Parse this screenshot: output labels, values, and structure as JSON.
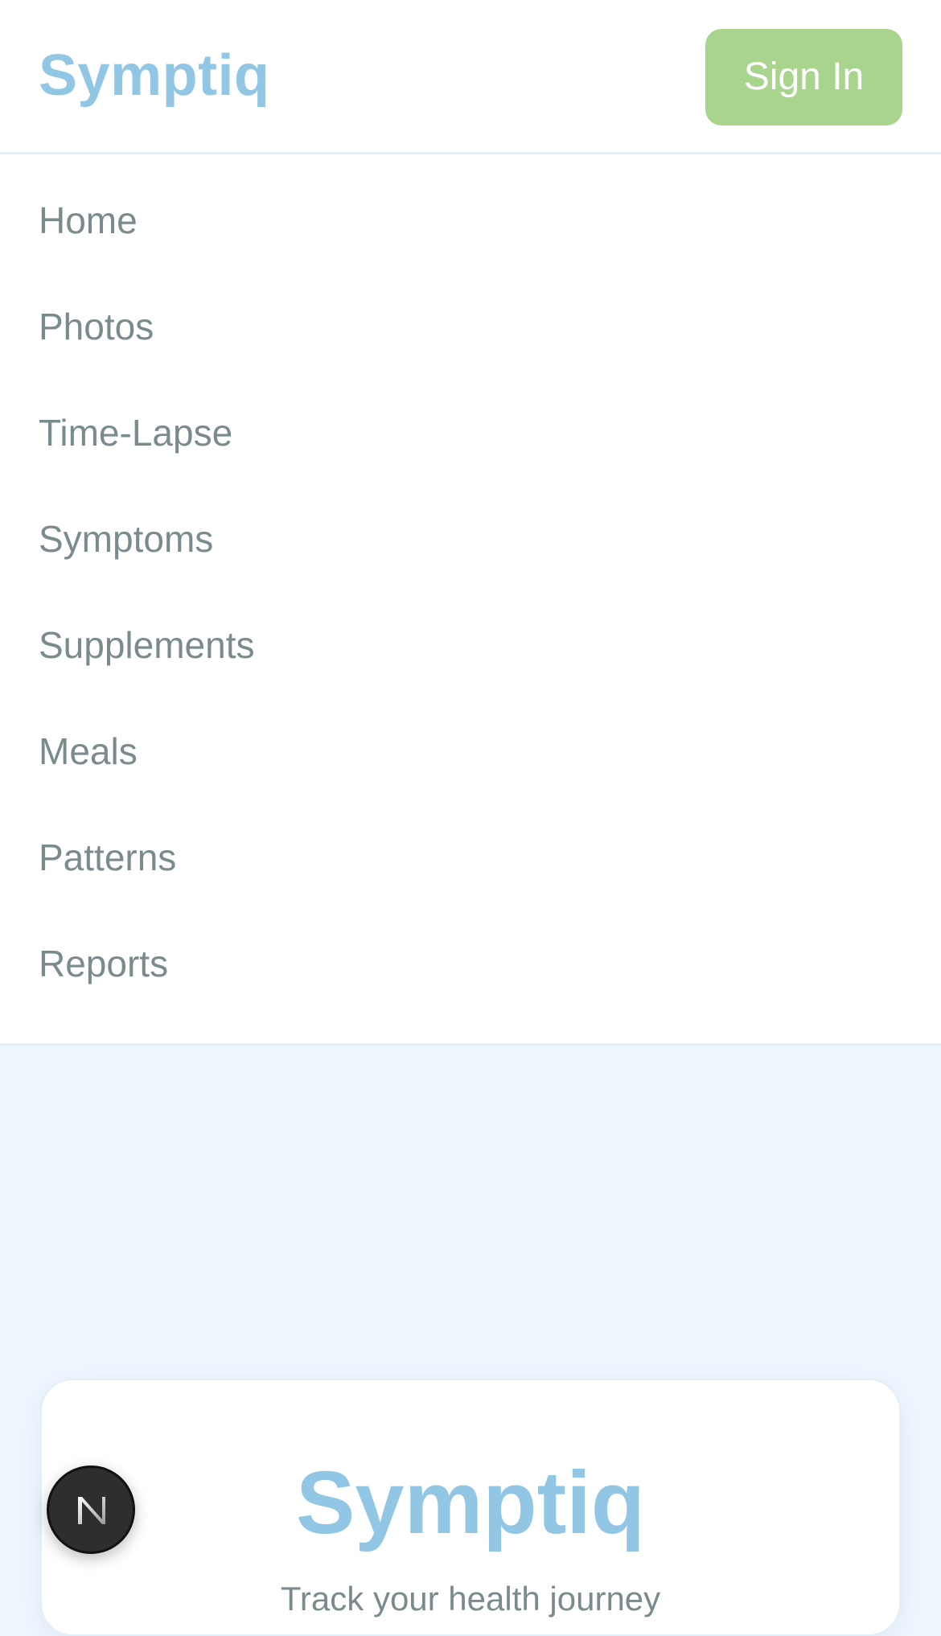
{
  "header": {
    "logo": "Symptiq",
    "signin_label": "Sign In"
  },
  "nav": {
    "items": [
      {
        "label": "Home"
      },
      {
        "label": "Photos"
      },
      {
        "label": "Time-Lapse"
      },
      {
        "label": "Symptoms"
      },
      {
        "label": "Supplements"
      },
      {
        "label": "Meals"
      },
      {
        "label": "Patterns"
      },
      {
        "label": "Reports"
      }
    ]
  },
  "hero": {
    "title": "Symptiq",
    "subtitle": "Track your health journey"
  },
  "dev_badge": {
    "icon": "nextjs-icon",
    "letter": "N"
  },
  "colors": {
    "brand": "#91c6e4",
    "accent": "#a8d48d",
    "nav_text": "#7a8b8e",
    "page_bg": "#eef6fe"
  }
}
